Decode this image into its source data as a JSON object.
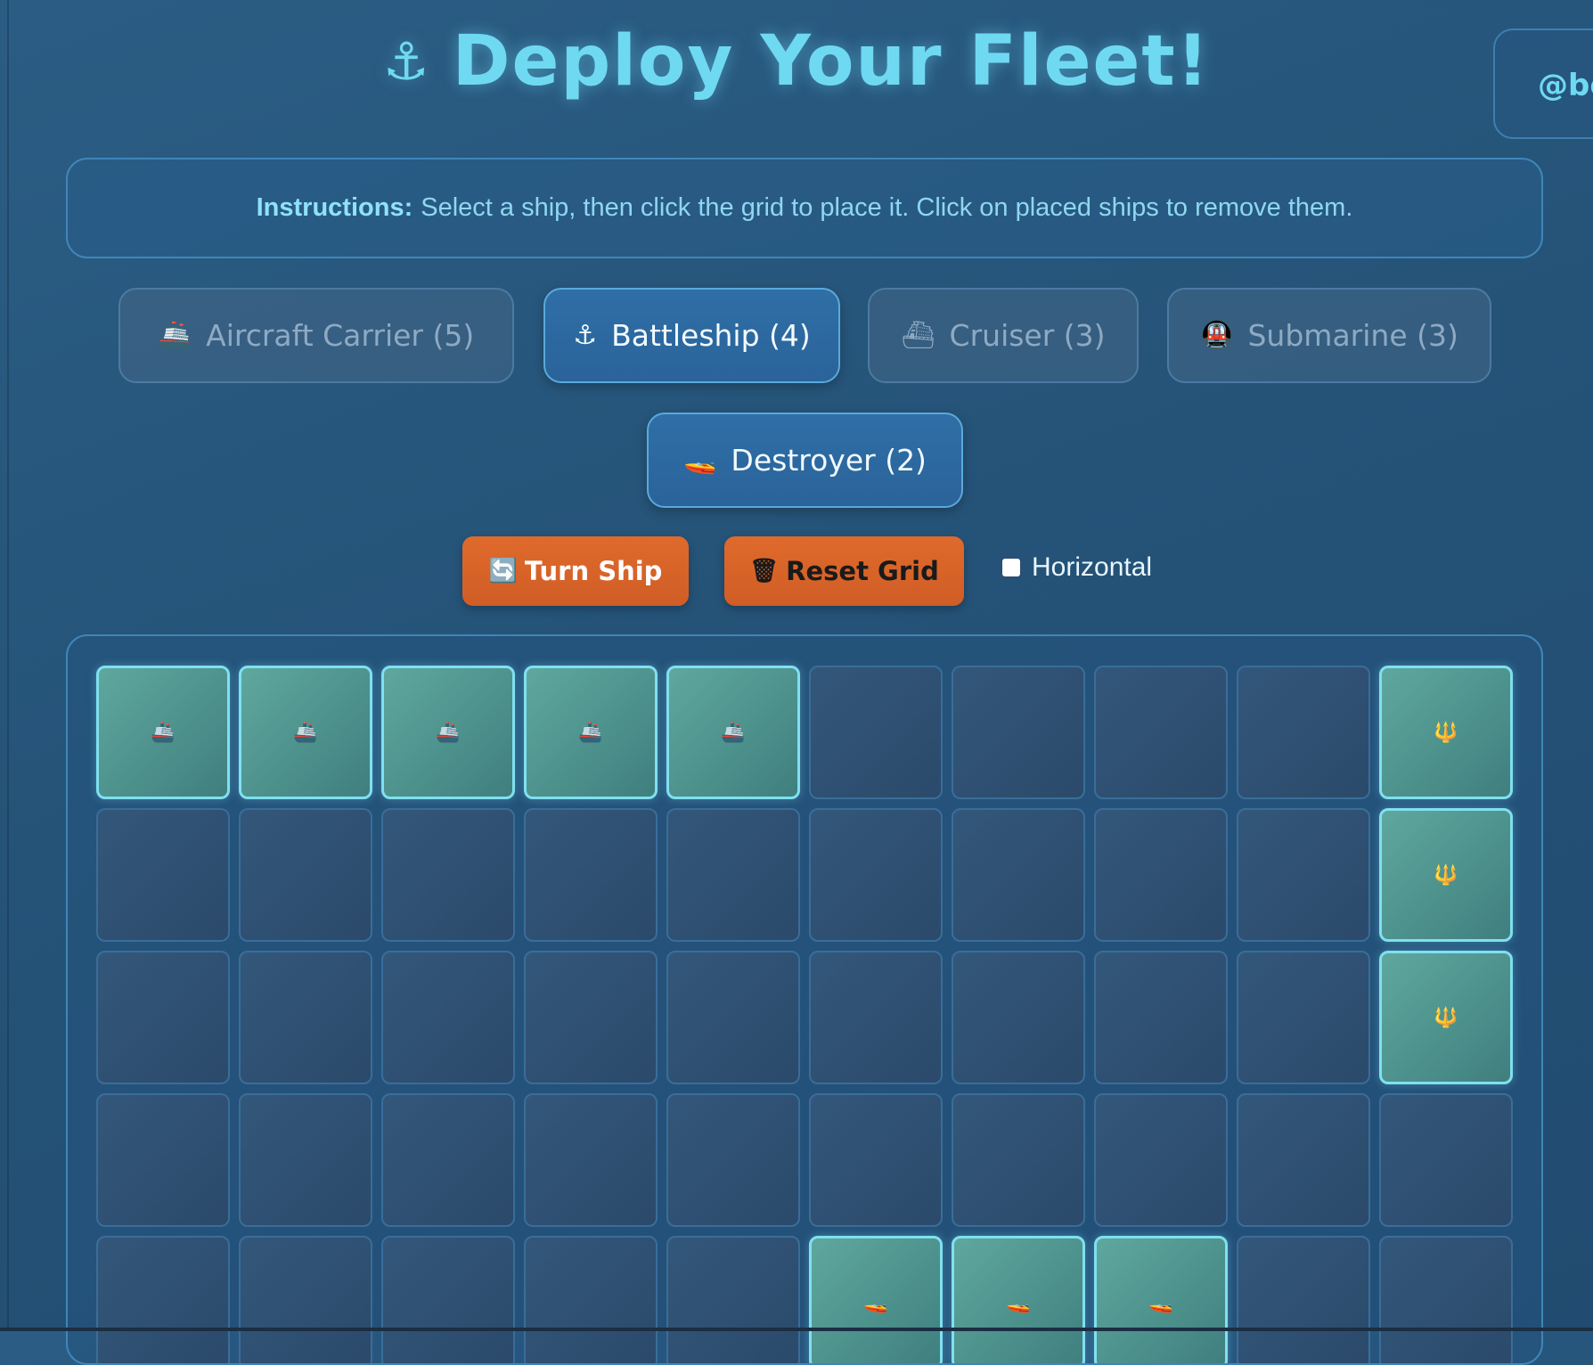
{
  "header": {
    "anchor_icon": "⚓",
    "title": "Deploy Your Fleet!",
    "user_handle": "@be"
  },
  "instructions": {
    "label": "Instructions:",
    "text": "Select a ship, then click the grid to place it. Click on placed ships to remove them."
  },
  "ships": [
    {
      "icon": "🚢",
      "icon_name": "ship-icon",
      "label": "Aircraft Carrier (5)",
      "state": "placed"
    },
    {
      "icon": "⚓",
      "icon_name": "anchor-icon",
      "label": "Battleship (4)",
      "state": "available"
    },
    {
      "icon": "⛴",
      "icon_name": "ferry-icon",
      "label": "Cruiser (3)",
      "state": "placed"
    },
    {
      "icon": "🚇",
      "icon_name": "submarine-icon",
      "label": "Submarine (3)",
      "state": "placed"
    },
    {
      "icon": "🚤",
      "icon_name": "speedboat-icon",
      "label": "Destroyer (2)",
      "state": "available"
    }
  ],
  "actions": {
    "turn_icon": "🔄",
    "turn_label": "Turn Ship",
    "turn_text_color": "#ffffff",
    "reset_icon": "🗑",
    "reset_label": "Reset Grid",
    "reset_text_color": "#1a1a1a"
  },
  "orientation": {
    "label": "Horizontal",
    "checked": false
  },
  "grid": {
    "rows_visible": 5,
    "cols": 10,
    "cells": [
      [
        "🚢",
        "🚢",
        "🚢",
        "🚢",
        "🚢",
        "",
        "",
        "",
        "",
        "🔱"
      ],
      [
        "",
        "",
        "",
        "",
        "",
        "",
        "",
        "",
        "",
        "🔱"
      ],
      [
        "",
        "",
        "",
        "",
        "",
        "",
        "",
        "",
        "",
        "🔱"
      ],
      [
        "",
        "",
        "",
        "",
        "",
        "",
        "",
        "",
        "",
        ""
      ],
      [
        "",
        "",
        "",
        "",
        "",
        "🚤",
        "🚤",
        "🚤",
        "",
        ""
      ]
    ]
  },
  "colors": {
    "accent": "#6fd9f2",
    "ship_cell": "#5fa89e",
    "empty_cell": "#2f5172",
    "action_orange": "#e06a2c"
  }
}
